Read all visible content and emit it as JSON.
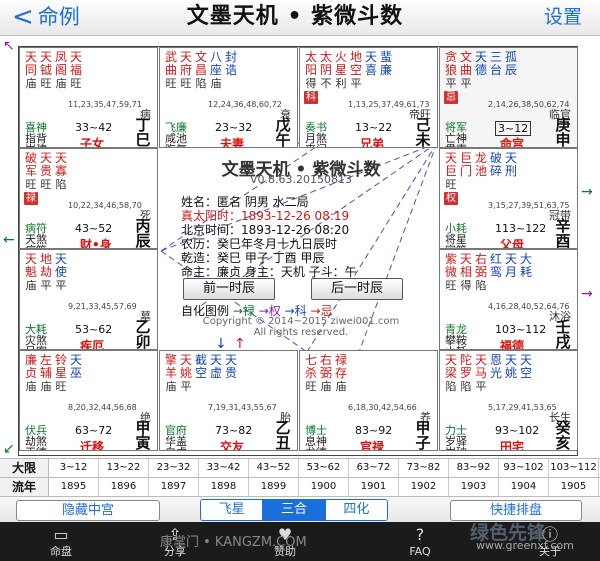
{
  "nav": {
    "back_label": "命例",
    "title": "文墨天机 • 紫微斗数",
    "settings_label": "设置"
  },
  "cells": [
    {
      "id": "si",
      "stars": [
        {
          "t": "天同",
          "b": "庙",
          "c": "red"
        },
        {
          "t": "天钺",
          "b": "旺",
          "c": "red"
        },
        {
          "t": "凤阁",
          "b": "庙",
          "c": "red"
        },
        {
          "t": "天福",
          "b": "旺",
          "c": "red"
        }
      ],
      "ages": "11,23,35,47,59,71",
      "cs": "病",
      "ss": [
        "喜神",
        "指背",
        "岁建"
      ],
      "rng": "33~42",
      "palace": "子女",
      "gz": "丁巳",
      "selected": false
    },
    {
      "id": "wu",
      "stars": [
        {
          "t": "武曲",
          "b": "旺",
          "c": "red"
        },
        {
          "t": "天府",
          "b": "旺",
          "c": "red"
        },
        {
          "t": "文昌",
          "b": "陷",
          "c": "red"
        },
        {
          "t": "八座",
          "b": "庙",
          "c": "blue"
        },
        {
          "t": "封诰",
          "b": "",
          "c": "blue"
        },
        {
          "t": "解神",
          "b": "庙",
          "c": "blue"
        },
        {
          "t": "阴煞",
          "b": "庙",
          "c": "blue"
        },
        {
          "t": "天哭",
          "b": "旺",
          "c": "blue"
        },
        {
          "t": "天厨",
          "b": "",
          "c": "blue"
        },
        {
          "t": "天德",
          "b": "",
          "c": "blue"
        }
      ],
      "ages": "12,24,36,48,60,72",
      "cs": "衰",
      "ss": [
        "飞廉",
        "咸池",
        "晦气"
      ],
      "rng": "23~32",
      "palace": "夫妻",
      "gz": "戊午",
      "selected": false
    },
    {
      "id": "wei",
      "stars": [
        {
          "t": "太阳",
          "b": "得",
          "c": "red"
        },
        {
          "t": "太阴",
          "b": "不",
          "c": "red"
        },
        {
          "t": "火星",
          "b": "利",
          "c": "red"
        },
        {
          "t": "地空",
          "b": "平",
          "c": "red"
        },
        {
          "t": "天喜",
          "b": "",
          "c": "blue"
        },
        {
          "t": "蜚廉",
          "b": "",
          "c": "blue"
        }
      ],
      "hua": "科",
      "ages": "1,13,25,37,49,61,73",
      "cs": "帝旺",
      "ss": [
        "奏书",
        "月煞",
        "丧门"
      ],
      "rng": "13~22",
      "palace": "兄弟",
      "gz": "己未",
      "selected": false
    },
    {
      "id": "shen",
      "stars": [
        {
          "t": "贪狼",
          "b": "平",
          "c": "red"
        },
        {
          "t": "文曲",
          "b": "平",
          "c": "red"
        },
        {
          "t": "天德",
          "b": "",
          "c": "blue"
        },
        {
          "t": "三台",
          "b": "",
          "c": "blue"
        },
        {
          "t": "孤辰",
          "b": "",
          "c": "blue"
        }
      ],
      "hua": "忌",
      "ages": "2,14,26,38,50,62,74",
      "cs": "临官",
      "ss": [
        "将军",
        "亡神",
        "贯索"
      ],
      "rng": "3~12",
      "palace": "命宫",
      "gz": "庚申",
      "selected": true
    },
    {
      "id": "chen",
      "stars": [
        {
          "t": "破军",
          "b": "旺",
          "c": "red"
        },
        {
          "t": "天贵",
          "b": "旺",
          "c": "red"
        },
        {
          "t": "天寡",
          "b": "陷",
          "c": "red"
        }
      ],
      "hua": "禄",
      "ages": "10,22,34,46,58,70",
      "cs": "死",
      "ss": [
        "病符",
        "天煞",
        "病符"
      ],
      "rng": "43~52",
      "palace": "财•身",
      "gz": "丙辰",
      "selected": false
    },
    {
      "id": "you",
      "stars": [
        {
          "t": "天巨",
          "b": "旺",
          "c": "red"
        },
        {
          "t": "巨门",
          "b": "",
          "c": "red"
        },
        {
          "t": "龙池",
          "b": "",
          "c": "red"
        },
        {
          "t": "破碎",
          "b": "",
          "c": "blue"
        },
        {
          "t": "天刑",
          "b": "",
          "c": "blue"
        }
      ],
      "hua": "权",
      "ages": "3,15,27,39,51,63,75",
      "cs": "冠带",
      "ss": [
        "小耗",
        "将星",
        "官符"
      ],
      "rng": "113~122",
      "palace": "父母",
      "gz": "辛酉",
      "selected": false
    },
    {
      "id": "mao",
      "stars": [
        {
          "t": "天魁",
          "b": "庙",
          "c": "red"
        },
        {
          "t": "地劫",
          "b": "平",
          "c": "red"
        },
        {
          "t": "天使",
          "b": "平",
          "c": "blue"
        }
      ],
      "ages": "9,21,33,45,57,69",
      "cs": "墓",
      "ss": [
        "大耗",
        "灾煞",
        "吊客"
      ],
      "rng": "53~62",
      "palace": "疾厄",
      "gz": "乙卯",
      "selected": false
    },
    {
      "id": "xu",
      "stars": [
        {
          "t": "紫微",
          "b": "旺",
          "c": "red"
        },
        {
          "t": "天相",
          "b": "得",
          "c": "red"
        },
        {
          "t": "右弼",
          "b": "陷",
          "c": "red"
        },
        {
          "t": "红鸾",
          "b": "",
          "c": "blue"
        },
        {
          "t": "天月",
          "b": "",
          "c": "blue"
        },
        {
          "t": "大耗",
          "b": "",
          "c": "blue"
        }
      ],
      "ages": "4,16,28,40,52,64,76",
      "cs": "沐浴",
      "ss": [
        "青龙",
        "攀鞍",
        "小耗"
      ],
      "rng": "103~112",
      "palace": "福德",
      "gz": "壬戌",
      "selected": false
    },
    {
      "id": "yin",
      "stars": [
        {
          "t": "廉贞",
          "b": "庙",
          "c": "red"
        },
        {
          "t": "左辅",
          "b": "庙",
          "c": "red"
        },
        {
          "t": "铃星",
          "b": "旺",
          "c": "red"
        },
        {
          "t": "天巫",
          "b": "",
          "c": "blue"
        }
      ],
      "ages": "8,20,32,44,56,68",
      "cs": "绝",
      "ss": [
        "伏兵",
        "劫煞",
        "天德"
      ],
      "rng": "63~72",
      "palace": "迁移",
      "gz": "甲寅",
      "selected": false
    },
    {
      "id": "chou",
      "stars": [
        {
          "t": "擎羊",
          "b": "庙",
          "c": "red"
        },
        {
          "t": "天姚",
          "b": "平",
          "c": "red"
        },
        {
          "t": "截空",
          "b": "",
          "c": "blue"
        },
        {
          "t": "天虚",
          "b": "",
          "c": "blue"
        },
        {
          "t": "天贵",
          "b": "",
          "c": "blue"
        }
      ],
      "ages": "7,19,31,43,55,67",
      "cs": "胎",
      "ss": [
        "官府",
        "华盖",
        "白虎"
      ],
      "rng": "73~82",
      "palace": "交友",
      "gz": "乙丑",
      "selected": false
    },
    {
      "id": "zi",
      "stars": [
        {
          "t": "七杀",
          "b": "旺",
          "c": "red"
        },
        {
          "t": "右弼",
          "b": "庙",
          "c": "red"
        },
        {
          "t": "禄存",
          "b": "庙",
          "c": "red"
        }
      ],
      "ages": "6,18,30,42,54,66",
      "cs": "养",
      "ss": [
        "博士",
        "息神",
        "龙德"
      ],
      "rng": "83~92",
      "palace": "官禄",
      "gz": "甲子",
      "selected": false
    },
    {
      "id": "hai",
      "stars": [
        {
          "t": "天梁",
          "b": "陷",
          "c": "red"
        },
        {
          "t": "陀罗",
          "b": "陷",
          "c": "red"
        },
        {
          "t": "天马",
          "b": "平",
          "c": "red"
        },
        {
          "t": "恩光",
          "b": "",
          "c": "blue"
        },
        {
          "t": "天姚",
          "b": "",
          "c": "blue"
        },
        {
          "t": "天空",
          "b": "",
          "c": "blue"
        }
      ],
      "ages": "5,17,29,41,53,65",
      "cs": "长生",
      "ss": [
        "力士",
        "岁驿",
        "岁破"
      ],
      "rng": "93~102",
      "palace": "田宅",
      "gz": "癸亥",
      "selected": false
    }
  ],
  "center": {
    "title": "文墨天机 • 紫微斗数",
    "version": "V0.8.63.20150813",
    "lines": [
      {
        "t": "姓名：匿名      阴男  水二局",
        "c": "black"
      },
      {
        "t": "真太阳时：1893-12-26  08:19",
        "c": "red"
      },
      {
        "t": "北京时间：1893-12-26  08:20",
        "c": "black"
      },
      {
        "t": "农历：癸巳年冬月十九日辰时",
        "c": "black"
      },
      {
        "t": "乾造：癸巳  甲子  丁酉  甲辰",
        "c": "black"
      },
      {
        "t": "命主：廉贞 身主：天机 子斗：午",
        "c": "black"
      }
    ],
    "prev_label": "前一时辰",
    "next_label": "后一时辰",
    "legend": {
      "label": "自化图例",
      "lu": "→禄",
      "quan": "→权",
      "ke": "→科",
      "ji": "→忌"
    },
    "copyright": "Copyright © 2014~2015 ziwei001.com",
    "rights": "All rights reserved."
  },
  "grid": {
    "row1_label": "大限",
    "row1": [
      "3~12",
      "13~22",
      "23~32",
      "33~42",
      "43~52",
      "53~62",
      "63~72",
      "73~82",
      "83~92",
      "93~102",
      "103~112"
    ],
    "row2_label": "流年",
    "row2": [
      "1895",
      "1896",
      "1897",
      "1898",
      "1899",
      "1900",
      "1901",
      "1902",
      "1903",
      "1904",
      "1905"
    ]
  },
  "actions": {
    "hide_label": "隐藏中宫",
    "seg": [
      "飞星",
      "三合",
      "四化"
    ],
    "seg_selected": "三合",
    "quick_label": "快捷排盘"
  },
  "tabs": [
    {
      "label": "命盘",
      "icon": "chart-icon"
    },
    {
      "label": "分享",
      "icon": "share-icon"
    },
    {
      "label": "赞助",
      "icon": "sponsor-icon"
    },
    {
      "label": "FAQ",
      "icon": "faq-icon"
    },
    {
      "label": "关于",
      "icon": "about-icon"
    }
  ],
  "watermark": {
    "mid": "康掌门 • KANGZM.COM",
    "brand": "绿色先锋",
    "url": "www.greenxf.com"
  },
  "colors": {
    "accent": "#1a6fd9",
    "red_star": "#d11919",
    "blue_star": "#1545b4",
    "green": "#0a7a28"
  }
}
